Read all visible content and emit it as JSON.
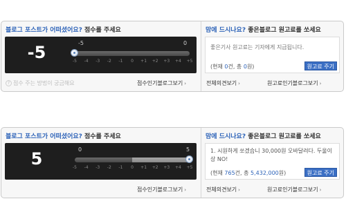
{
  "widgets": [
    {
      "title_question": "블로그 포스트가 어떠셨어요?",
      "title_sub": "점수를 주세요",
      "score": "-5",
      "scale_min_label": "-5",
      "scale_max_label": "0",
      "slider_value": -5,
      "ticks": [
        "-5",
        "-4",
        "-3",
        "-2",
        "-1",
        "0",
        "+1",
        "+2",
        "+3",
        "+4",
        "+5"
      ],
      "help_text": "점수 주는 방법이 궁금해요",
      "popular_link": "점수인기블로그보기",
      "donate_title_q": "맘에 드시나요?",
      "donate_title_s": "좋은블로그 원고료를 쏘세요",
      "donate_message": "좋은기사 원고료는 기자에게 지급됩니다.",
      "count_prefix": "(현재",
      "count_num": "0",
      "count_mid": "건, 총",
      "count_amount": "0",
      "count_suffix": "원)",
      "pay_button": "원고료 주기",
      "all_opinions_link": "전체의견보기",
      "donate_popular_link": "원고료인기블로그보기"
    },
    {
      "title_question": "블로그 포스트가 어떠셨어요?",
      "title_sub": "점수를 주세요",
      "score": "5",
      "scale_min_label": "0",
      "scale_max_label": "5",
      "slider_value": 5,
      "ticks": [
        "-5",
        "-4",
        "-3",
        "-2",
        "-1",
        "0",
        "+1",
        "+2",
        "+3",
        "+4",
        "+5"
      ],
      "popular_link": "점수인기블로그보기",
      "donate_title_q": "맘에 드시나요?",
      "donate_title_s": "좋은블로그 원고료를 쏘세요",
      "donate_message": "1. 시원하게 쏘겠습니 30,000원 오바달려다. 두울이상 NO!",
      "count_prefix": "(현재",
      "count_num": "765",
      "count_mid": "건, 총",
      "count_amount": "5,432,000",
      "count_suffix": "원)",
      "pay_button": "원고료 주기",
      "all_opinions_link": "전체의견보기",
      "donate_popular_link": "원고료인기블로그보기"
    }
  ],
  "colors": {
    "accent_blue": "#2c62b8",
    "panel_dark": "#1e1e1e",
    "button_blue": "#3b6fc4"
  }
}
